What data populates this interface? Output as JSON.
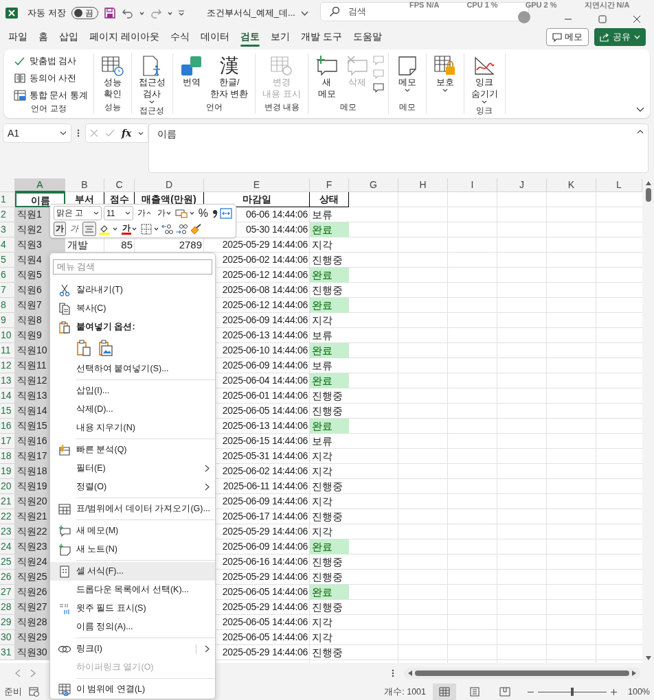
{
  "title_bar": {
    "autosave_label": "자동 저장",
    "autosave_on": false,
    "autosave_state": "끔",
    "file_name": "조건부서식_예제_데...",
    "search_placeholder": "검색",
    "overlay": [
      "FPS N/A",
      "CPU 1 %",
      "GPU 2 %",
      "지연시간 N/A"
    ]
  },
  "menu_tabs": [
    {
      "label": "파일",
      "selected": false
    },
    {
      "label": "홈",
      "selected": false
    },
    {
      "label": "삽입",
      "selected": false
    },
    {
      "label": "페이지 레이아웃",
      "selected": false
    },
    {
      "label": "수식",
      "selected": false
    },
    {
      "label": "데이터",
      "selected": false
    },
    {
      "label": "검토",
      "selected": true
    },
    {
      "label": "보기",
      "selected": false
    },
    {
      "label": "개발 도구",
      "selected": false
    },
    {
      "label": "도움말",
      "selected": false
    }
  ],
  "memo_button": "메모",
  "share_button": "공유",
  "ribbon_groups": [
    {
      "label": "언어 교정",
      "kind": "small",
      "items": [
        {
          "label": "맞춤법 검사"
        },
        {
          "label": "동의어 사전"
        },
        {
          "label": "통합 문서 통계"
        }
      ]
    },
    {
      "label": "성능",
      "kind": "large",
      "items": [
        {
          "label": "성능\n확인",
          "dropdown": false,
          "disabled": false
        }
      ]
    },
    {
      "label": "접근성",
      "kind": "large",
      "items": [
        {
          "label": "접근성\n검사",
          "dropdown": true,
          "disabled": false
        }
      ]
    },
    {
      "label": "언어",
      "kind": "large",
      "items": [
        {
          "label": "번역",
          "dropdown": false,
          "disabled": false
        },
        {
          "label": "한글/\n한자 변환",
          "glyph": "漢",
          "dropdown": false,
          "disabled": false
        }
      ]
    },
    {
      "label": "변경 내용",
      "kind": "large",
      "items": [
        {
          "label": "변경\n내용 표시",
          "dropdown": false,
          "disabled": true
        }
      ]
    },
    {
      "label": "메모",
      "kind": "large",
      "items": [
        {
          "label": "새\n메모",
          "dropdown": false,
          "disabled": false
        },
        {
          "label": "삭제",
          "dropdown": false,
          "disabled": true
        }
      ],
      "icon_buttons": [
        {
          "disabled": true
        },
        {
          "disabled": true
        },
        {
          "disabled": false
        }
      ]
    },
    {
      "label": "메모",
      "kind": "large",
      "items": [
        {
          "label": "메모",
          "dropdown": true,
          "disabled": false
        }
      ]
    },
    {
      "kind": "large",
      "items": [
        {
          "label": "보호",
          "dropdown": true,
          "disabled": false
        }
      ]
    },
    {
      "label": "잉크",
      "kind": "large",
      "items": [
        {
          "label": "잉크\n숨기기",
          "dropdown": true,
          "disabled": false
        }
      ]
    }
  ],
  "formula_bar": {
    "name_box": "A1",
    "fx_label": "fx",
    "formula": "이름"
  },
  "sheet": {
    "columns": [
      {
        "label": "A",
        "selected": true
      },
      {
        "label": "B",
        "selected": false
      },
      {
        "label": "C",
        "selected": false
      },
      {
        "label": "D",
        "selected": false
      },
      {
        "label": "E",
        "selected": false
      },
      {
        "label": "F",
        "selected": false
      },
      {
        "label": "G",
        "selected": false
      },
      {
        "label": "H",
        "selected": false
      },
      {
        "label": "I",
        "selected": false
      },
      {
        "label": "J",
        "selected": false
      },
      {
        "label": "K",
        "selected": false
      },
      {
        "label": "L",
        "selected": false
      }
    ],
    "header_row": {
      "num": "1",
      "cells": [
        "이름",
        "부서",
        "점수",
        "매출액(만원)",
        "마감일",
        "상태"
      ]
    },
    "rows": [
      {
        "num": "2",
        "name": "직원1",
        "due": "06-06 14:44:06",
        "status": "보류",
        "highlight": false
      },
      {
        "num": "3",
        "name": "직원2",
        "due": "05-30 14:44:06",
        "status": "완료",
        "highlight": true
      },
      {
        "num": "4",
        "name": "직원3",
        "dept": "개발",
        "score": "85",
        "sales": "2789",
        "due": "2025-05-29 14:44:06",
        "status": "지각",
        "highlight": false
      },
      {
        "num": "5",
        "name": "직원4",
        "due": "2025-06-02 14:44:06",
        "status": "진행중",
        "highlight": false
      },
      {
        "num": "6",
        "name": "직원5",
        "due": "2025-06-12 14:44:06",
        "status": "완료",
        "highlight": true
      },
      {
        "num": "7",
        "name": "직원6",
        "due": "2025-06-08 14:44:06",
        "status": "진행중",
        "highlight": false
      },
      {
        "num": "8",
        "name": "직원7",
        "due": "2025-06-12 14:44:06",
        "status": "완료",
        "highlight": true
      },
      {
        "num": "9",
        "name": "직원8",
        "due": "2025-06-09 14:44:06",
        "status": "지각",
        "highlight": false
      },
      {
        "num": "10",
        "name": "직원9",
        "due": "2025-06-13 14:44:06",
        "status": "보류",
        "highlight": false
      },
      {
        "num": "11",
        "name": "직원10",
        "due": "2025-06-10 14:44:06",
        "status": "완료",
        "highlight": true
      },
      {
        "num": "12",
        "name": "직원11",
        "due": "2025-06-09 14:44:06",
        "status": "보류",
        "highlight": false
      },
      {
        "num": "13",
        "name": "직원12",
        "due": "2025-06-04 14:44:06",
        "status": "완료",
        "highlight": true
      },
      {
        "num": "14",
        "name": "직원13",
        "due": "2025-06-01 14:44:06",
        "status": "진행중",
        "highlight": false
      },
      {
        "num": "15",
        "name": "직원14",
        "due": "2025-06-05 14:44:06",
        "status": "진행중",
        "highlight": false
      },
      {
        "num": "16",
        "name": "직원15",
        "due": "2025-06-13 14:44:06",
        "status": "완료",
        "highlight": true
      },
      {
        "num": "17",
        "name": "직원16",
        "due": "2025-06-15 14:44:06",
        "status": "보류",
        "highlight": false
      },
      {
        "num": "18",
        "name": "직원17",
        "due": "2025-05-31 14:44:06",
        "status": "지각",
        "highlight": false
      },
      {
        "num": "19",
        "name": "직원18",
        "due": "2025-06-02 14:44:06",
        "status": "지각",
        "highlight": false
      },
      {
        "num": "20",
        "name": "직원19",
        "due": "2025-06-11 14:44:06",
        "status": "진행중",
        "highlight": false
      },
      {
        "num": "21",
        "name": "직원20",
        "due": "2025-06-09 14:44:06",
        "status": "지각",
        "highlight": false
      },
      {
        "num": "22",
        "name": "직원21",
        "due": "2025-06-17 14:44:06",
        "status": "진행중",
        "highlight": false
      },
      {
        "num": "23",
        "name": "직원22",
        "due": "2025-05-29 14:44:06",
        "status": "지각",
        "highlight": false
      },
      {
        "num": "24",
        "name": "직원23",
        "due": "2025-06-09 14:44:06",
        "status": "완료",
        "highlight": true
      },
      {
        "num": "25",
        "name": "직원24",
        "due": "2025-06-16 14:44:06",
        "status": "진행중",
        "highlight": false
      },
      {
        "num": "26",
        "name": "직원25",
        "due": "2025-05-29 14:44:06",
        "status": "진행중",
        "highlight": false
      },
      {
        "num": "27",
        "name": "직원26",
        "due": "2025-06-05 14:44:06",
        "status": "완료",
        "highlight": true
      },
      {
        "num": "28",
        "name": "직원27",
        "due": "2025-05-29 14:44:06",
        "status": "진행중",
        "highlight": false
      },
      {
        "num": "29",
        "name": "직원28",
        "due": "2025-06-05 14:44:06",
        "status": "지각",
        "highlight": false
      },
      {
        "num": "30",
        "name": "직원29",
        "due": "2025-06-05 14:44:06",
        "status": "지각",
        "highlight": false
      },
      {
        "num": "31",
        "name": "직원30",
        "due": "2025-05-29 14:44:06",
        "status": "진행중",
        "highlight": false
      }
    ]
  },
  "mini_toolbar": {
    "font": "맑은 고",
    "size": "11",
    "grow_glyph": "가",
    "shrink_glyph": "가",
    "percent": "%",
    "bold": {
      "glyph": "가",
      "selected": true
    },
    "italic": {
      "glyph": "가",
      "selected": false
    },
    "center_selected": true,
    "font_color_glyph": "가"
  },
  "context_menu": {
    "search_placeholder": "메뉴 검색",
    "items": [
      {
        "kind": "item",
        "label": "잘라내기(T)",
        "submenu": false,
        "disabled": false,
        "highlighted": false
      },
      {
        "kind": "item",
        "label": "복사(C)",
        "submenu": false,
        "disabled": false,
        "highlighted": false
      },
      {
        "kind": "header",
        "label": "붙여넣기 옵션:"
      },
      {
        "kind": "paste_options"
      },
      {
        "kind": "item",
        "label": "선택하여 붙여넣기(S)...",
        "submenu": false,
        "disabled": false,
        "highlighted": false
      },
      {
        "kind": "separator"
      },
      {
        "kind": "item",
        "label": "삽입(I)...",
        "submenu": false,
        "disabled": false,
        "highlighted": false
      },
      {
        "kind": "item",
        "label": "삭제(D)...",
        "submenu": false,
        "disabled": false,
        "highlighted": false
      },
      {
        "kind": "item",
        "label": "내용 지우기(N)",
        "submenu": false,
        "disabled": false,
        "highlighted": false
      },
      {
        "kind": "separator"
      },
      {
        "kind": "item",
        "label": "빠른 분석(Q)",
        "submenu": false,
        "disabled": false,
        "highlighted": false
      },
      {
        "kind": "item",
        "label": "필터(E)",
        "submenu": true,
        "disabled": false,
        "highlighted": false
      },
      {
        "kind": "item",
        "label": "정렬(O)",
        "submenu": true,
        "disabled": false,
        "highlighted": false
      },
      {
        "kind": "separator"
      },
      {
        "kind": "item",
        "label": "표/범위에서 데이터 가져오기(G)...",
        "submenu": false,
        "disabled": false,
        "highlighted": false
      },
      {
        "kind": "separator"
      },
      {
        "kind": "item",
        "label": "새 메모(M)",
        "submenu": false,
        "disabled": false,
        "highlighted": false
      },
      {
        "kind": "item",
        "label": "새 노트(N)",
        "submenu": false,
        "disabled": false,
        "highlighted": false
      },
      {
        "kind": "separator"
      },
      {
        "kind": "item",
        "label": "셀 서식(F)...",
        "submenu": false,
        "disabled": false,
        "highlighted": true
      },
      {
        "kind": "item",
        "label": "드롭다운 목록에서 선택(K)...",
        "submenu": false,
        "disabled": false,
        "highlighted": false
      },
      {
        "kind": "item",
        "label": "윗주 필드 표시(S)",
        "submenu": false,
        "disabled": false,
        "highlighted": false
      },
      {
        "kind": "item",
        "label": "이름 정의(A)...",
        "submenu": false,
        "disabled": false,
        "highlighted": false
      },
      {
        "kind": "separator"
      },
      {
        "kind": "item",
        "label": "링크(I)",
        "submenu": true,
        "disabled": false,
        "highlighted": false
      },
      {
        "kind": "item",
        "label": "하이퍼링크 열기(O)",
        "submenu": false,
        "disabled": true,
        "highlighted": false
      },
      {
        "kind": "separator"
      },
      {
        "kind": "item",
        "label": "이 범위에 연결(L)",
        "submenu": false,
        "disabled": false,
        "highlighted": false
      }
    ]
  },
  "status_bar": {
    "ready": "준비",
    "count": "개수: 1001",
    "views": [
      {
        "selected": true
      },
      {
        "selected": false
      },
      {
        "selected": false
      }
    ],
    "zoom": {
      "level": 0.5,
      "reading": "100%"
    }
  }
}
